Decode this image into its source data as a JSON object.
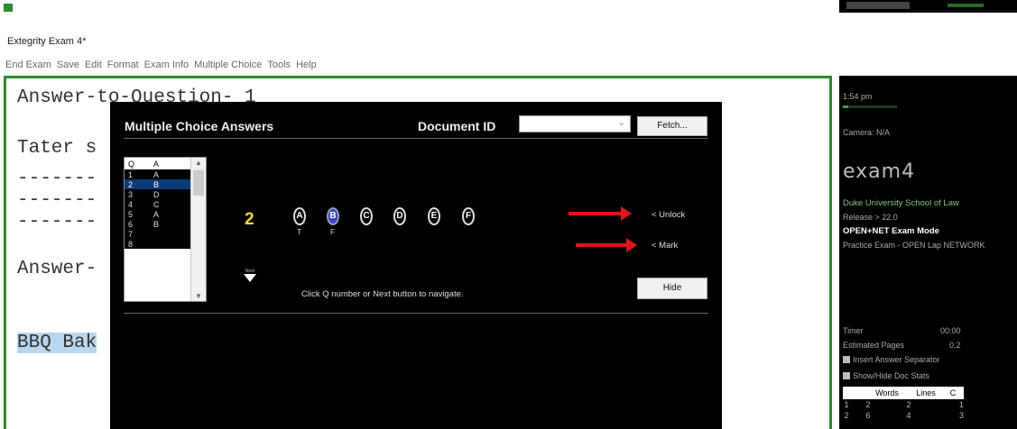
{
  "window": {
    "title": "Extegrity Exam 4*"
  },
  "menu": [
    "End Exam",
    "Save",
    "Edit",
    "Format",
    "Exam Info",
    "Multiple Choice",
    "Tools",
    "Help"
  ],
  "editor": {
    "lines": [
      "Answer-to-Question- 1",
      "Tater s",
      "-------",
      "-------",
      "-------",
      "Answer-",
      "BBQ Bak"
    ]
  },
  "dialog": {
    "title": "Multiple Choice Answers",
    "document_id_label": "Document ID",
    "document_id_value": "",
    "fetch_label": "Fetch...",
    "hide_label": "Hide",
    "list_headers": {
      "q": "Q",
      "a": "A"
    },
    "rows": [
      {
        "q": "1",
        "a": "A"
      },
      {
        "q": "2",
        "a": "B",
        "selected": true
      },
      {
        "q": "3",
        "a": "D"
      },
      {
        "q": "4",
        "a": "C"
      },
      {
        "q": "5",
        "a": "A"
      },
      {
        "q": "6",
        "a": "B"
      },
      {
        "q": "7",
        "a": ""
      },
      {
        "q": "8",
        "a": ""
      }
    ],
    "current_question": "2",
    "options": [
      "A",
      "B",
      "C",
      "D",
      "E",
      "F"
    ],
    "selected_option": "B",
    "true_label": "T",
    "false_label": "F",
    "next_label": "Next",
    "navigation_hint": "Click Q number or Next button to navigate.",
    "unlock_label": "< Unlock",
    "mark_label": "< Mark"
  },
  "sidebar": {
    "time": "1:54 pm",
    "camera": "Camera: N/A",
    "logo": "exam4",
    "school": "Duke University School of Law",
    "release": "Release > 22.0",
    "mode": "OPEN+NET Exam Mode",
    "exam_name": "Practice Exam - OPEN Lap NETWORK",
    "timer_label": "Timer",
    "timer_value": "00:00",
    "pages_label": "Estimated Pages",
    "pages_value": "0.2",
    "insert_separator_label": "Insert Answer Separator",
    "show_hide_stats_label": "Show/Hide Doc Stats",
    "stats_headers": [
      "",
      "Words",
      "Lines",
      "C"
    ],
    "stats_rows": [
      [
        "1",
        "2",
        "2",
        "1"
      ],
      [
        "2",
        "6",
        "4",
        "3"
      ]
    ]
  },
  "colors": {
    "accent_green": "#2e8b2e",
    "selection_blue": "#0b3b7a",
    "highlight": "#b9d7ee",
    "arrow_red": "#e0141a",
    "question_yellow": "#f5d63a"
  }
}
